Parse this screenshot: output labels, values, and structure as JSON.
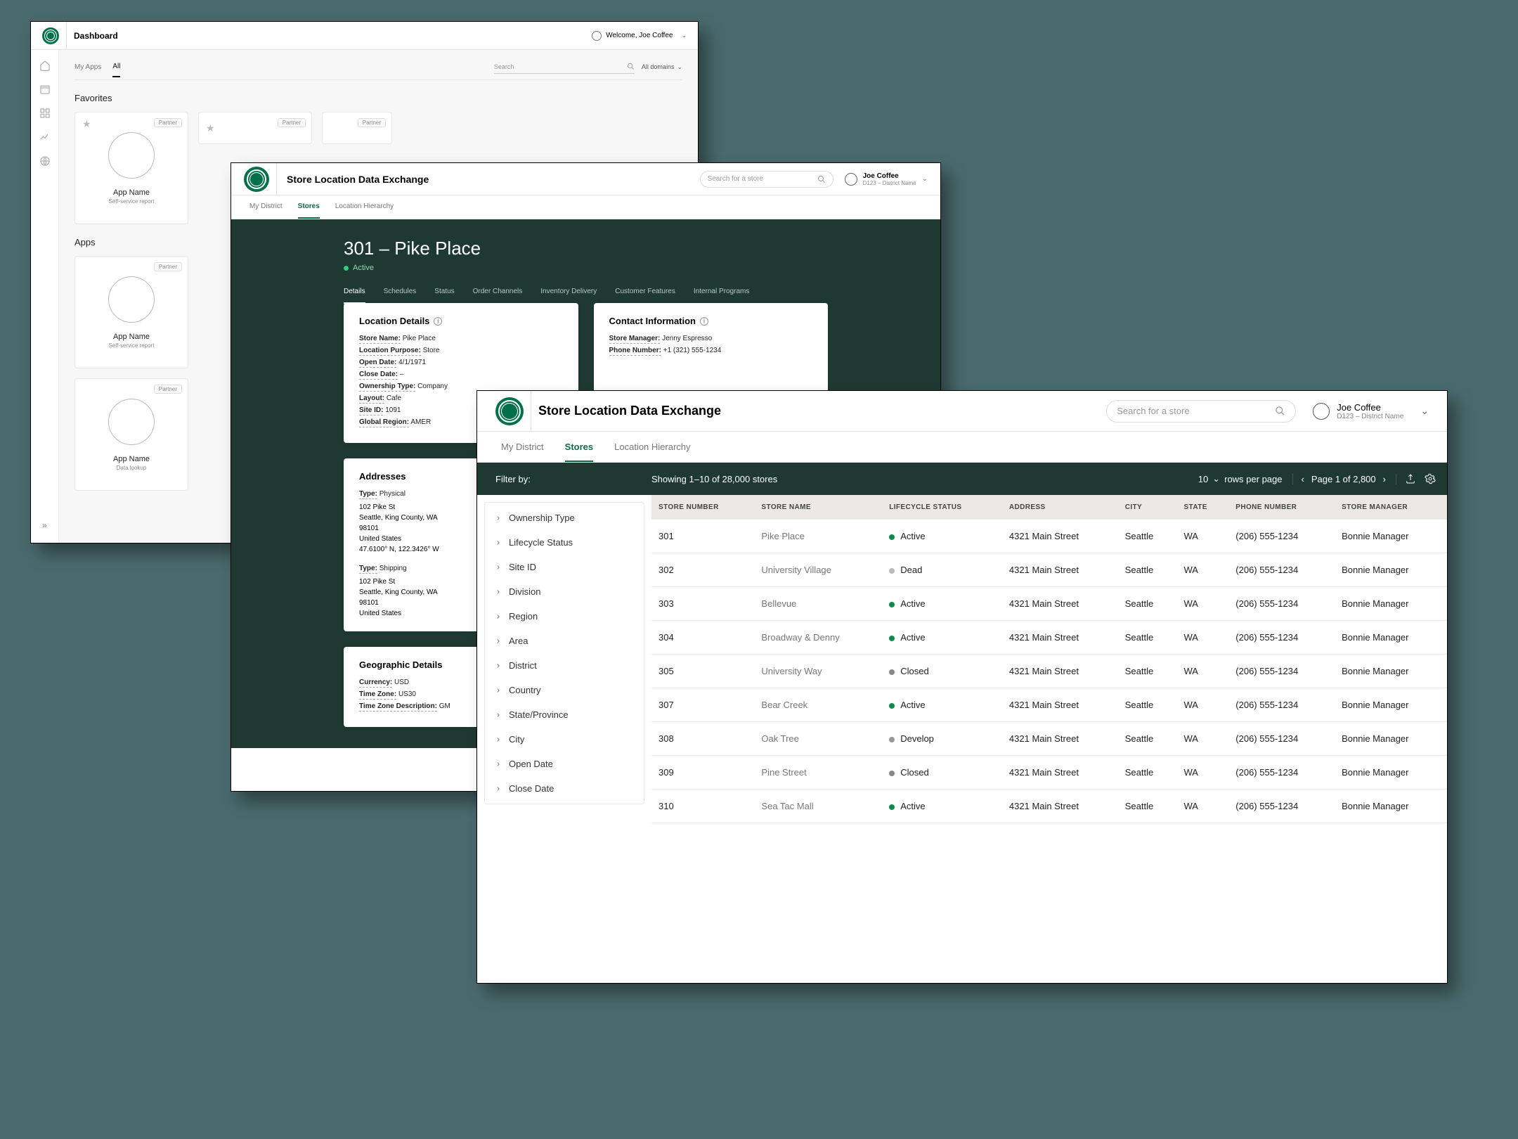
{
  "windowA": {
    "title": "Dashboard",
    "welcome": "Welcome, Joe Coffee",
    "tabs": {
      "myApps": "My Apps",
      "all": "All"
    },
    "search_ph": "Search",
    "domain_label": "All domains",
    "favoritesTitle": "Favorites",
    "appsTitle": "Apps",
    "partner": "Partner",
    "appName": "App Name",
    "sub1": "Self-service report",
    "sub2": "Data lookup"
  },
  "windowB": {
    "appTitle": "Store Location Data Exchange",
    "search_ph": "Search for a store",
    "user": {
      "name": "Joe Coffee",
      "sub": "D123 – District Name"
    },
    "tabs": [
      "My District",
      "Stores",
      "Location Hierarchy"
    ],
    "hero": {
      "title": "301 – Pike Place",
      "status": "Active"
    },
    "subtabs": [
      "Details",
      "Schedules",
      "Status",
      "Order Channels",
      "Inventory Delivery",
      "Customer Features",
      "Internal Programs"
    ],
    "locDetails": {
      "title": "Location Details",
      "storeName": "Pike Place",
      "purpose": "Store",
      "openDate": "4/1/1971",
      "closeDate": "–",
      "ownership": "Company",
      "layout": "Cafe",
      "siteId": "1091",
      "region": "AMER"
    },
    "contact": {
      "title": "Contact Information",
      "manager": "Jenny Espresso",
      "phone": "+1 (321) 555-1234"
    },
    "addresses": {
      "title": "Addresses",
      "physType": "Physical",
      "line1": "102 Pike St",
      "line2": "Seattle, King County, WA",
      "line3": "98101",
      "line4": "United States",
      "coords": "47.6100° N, 122.3426° W",
      "shipType": "Shipping"
    },
    "geo": {
      "title": "Geographic Details",
      "currency": "USD",
      "tz": "US30",
      "tzDesc": "GM"
    },
    "labels": {
      "storeName": "Store Name:",
      "purpose": "Location Purpose:",
      "openDate": "Open Date:",
      "closeDate": "Close Date:",
      "ownership": "Ownership Type:",
      "layout": "Layout:",
      "siteId": "Site ID:",
      "region": "Global Region:",
      "manager": "Store Manager:",
      "phone": "Phone Number:",
      "type": "Type:",
      "currency": "Currency:",
      "tz": "Time Zone:",
      "tzDesc": "Time Zone Description:"
    }
  },
  "windowC": {
    "appTitle": "Store Location Data Exchange",
    "search_ph": "Search for a store",
    "user": {
      "name": "Joe Coffee",
      "sub": "D123 – District Name"
    },
    "tabs": [
      "My District",
      "Stores",
      "Location Hierarchy"
    ],
    "filterBy": "Filter by:",
    "showing": "Showing 1–10 of 28,000 stores",
    "rpp_val": "10",
    "rpp_lbl": "rows per page",
    "page": "Page 1 of 2,800",
    "filters": [
      "Ownership Type",
      "Lifecycle Status",
      "Site ID",
      "Division",
      "Region",
      "Area",
      "District",
      "Country",
      "State/Province",
      "City",
      "Open Date",
      "Close Date"
    ],
    "columns": [
      "STORE NUMBER",
      "STORE NAME",
      "LIFECYCLE STATUS",
      "ADDRESS",
      "CITY",
      "STATE",
      "PHONE NUMBER",
      "STORE MANAGER"
    ],
    "rows": [
      {
        "num": "301",
        "name": "Pike Place",
        "status": "Active",
        "addr": "4321 Main Street",
        "city": "Seattle",
        "state": "WA",
        "phone": "(206) 555-1234",
        "mgr": "Bonnie Manager"
      },
      {
        "num": "302",
        "name": "University Village",
        "status": "Dead",
        "addr": "4321 Main Street",
        "city": "Seattle",
        "state": "WA",
        "phone": "(206) 555-1234",
        "mgr": "Bonnie Manager"
      },
      {
        "num": "303",
        "name": "Bellevue",
        "status": "Active",
        "addr": "4321 Main Street",
        "city": "Seattle",
        "state": "WA",
        "phone": "(206) 555-1234",
        "mgr": "Bonnie Manager"
      },
      {
        "num": "304",
        "name": "Broadway & Denny",
        "status": "Active",
        "addr": "4321 Main Street",
        "city": "Seattle",
        "state": "WA",
        "phone": "(206) 555-1234",
        "mgr": "Bonnie Manager"
      },
      {
        "num": "305",
        "name": "University Way",
        "status": "Closed",
        "addr": "4321 Main Street",
        "city": "Seattle",
        "state": "WA",
        "phone": "(206) 555-1234",
        "mgr": "Bonnie Manager"
      },
      {
        "num": "307",
        "name": "Bear Creek",
        "status": "Active",
        "addr": "4321 Main Street",
        "city": "Seattle",
        "state": "WA",
        "phone": "(206) 555-1234",
        "mgr": "Bonnie Manager"
      },
      {
        "num": "308",
        "name": "Oak Tree",
        "status": "Develop",
        "addr": "4321 Main Street",
        "city": "Seattle",
        "state": "WA",
        "phone": "(206) 555-1234",
        "mgr": "Bonnie Manager"
      },
      {
        "num": "309",
        "name": "Pine Street",
        "status": "Closed",
        "addr": "4321 Main Street",
        "city": "Seattle",
        "state": "WA",
        "phone": "(206) 555-1234",
        "mgr": "Bonnie Manager"
      },
      {
        "num": "310",
        "name": "Sea Tac Mall",
        "status": "Active",
        "addr": "4321 Main Street",
        "city": "Seattle",
        "state": "WA",
        "phone": "(206) 555-1234",
        "mgr": "Bonnie Manager"
      }
    ]
  }
}
